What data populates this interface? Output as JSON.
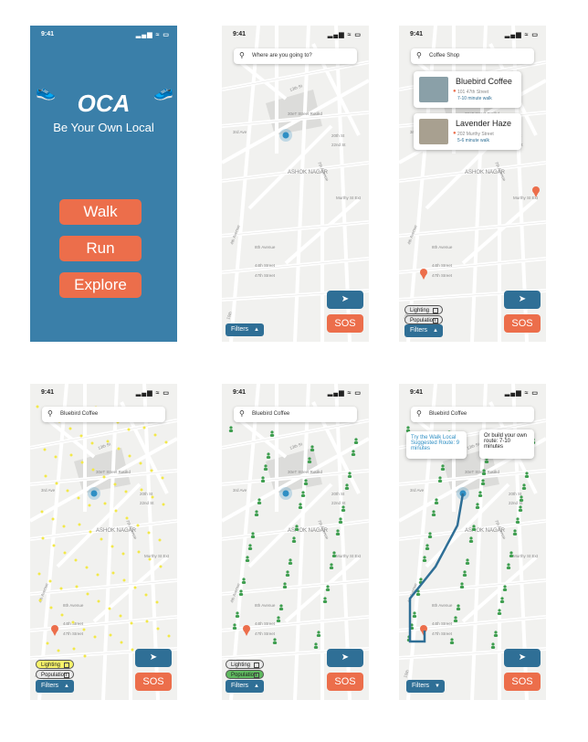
{
  "status": {
    "time": "9:41",
    "icons": "▂▄▆ ≈ ▭"
  },
  "splash": {
    "logo": "OCA",
    "tagline": "Be Your Own Local",
    "buttons": [
      "Walk",
      "Run",
      "Explore"
    ]
  },
  "map_labels": {
    "street_13": "13th St",
    "street_30": "30eT Street Round",
    "ave_3": "3rd Ave",
    "street_20": "20th St",
    "street_22": "22nd St",
    "area": "ASHOK NAGAR",
    "avenue_7": "7th Avenue",
    "murthy": "Murthy St Ext",
    "avenue_4": "4th Avenue",
    "avenue_8": "8th Avenue",
    "street_44": "44th Street",
    "street_47": "47th Street",
    "ave_ten": "10th"
  },
  "search_icon": "magnifier-icon",
  "screens": {
    "s2": {
      "placeholder": "Where are you going to?"
    },
    "s3": {
      "query": "Coffee Shop",
      "results": [
        {
          "name": "Bluebird Coffee",
          "address": "101 47th Street",
          "walk": "7-10 minute walk"
        },
        {
          "name": "Lavender Haze",
          "address": "202 Murthy Street",
          "walk": "5-6 minute walk"
        }
      ]
    },
    "s4": {
      "query": "Bluebird Coffee"
    },
    "s5": {
      "query": "Bluebird Coffee"
    },
    "s6": {
      "query": "Bluebird Coffee",
      "tip_left": "Try the Walk Local Suggested Route: 9 minutes",
      "tip_right": "Or build your own route: 7-10 minutes"
    }
  },
  "controls": {
    "sos": "SOS",
    "filters": "Filters",
    "nav_icon": "➤",
    "lighting": "Lighting",
    "population": "Population",
    "arrow_up": "▲",
    "arrow_down": "▼"
  },
  "colors": {
    "accent": "#2f6f96",
    "sos": "#ec6e4b",
    "splash_bg": "#3a7fa9",
    "lighting": "#f7f36a",
    "population": "#5fb95f"
  }
}
